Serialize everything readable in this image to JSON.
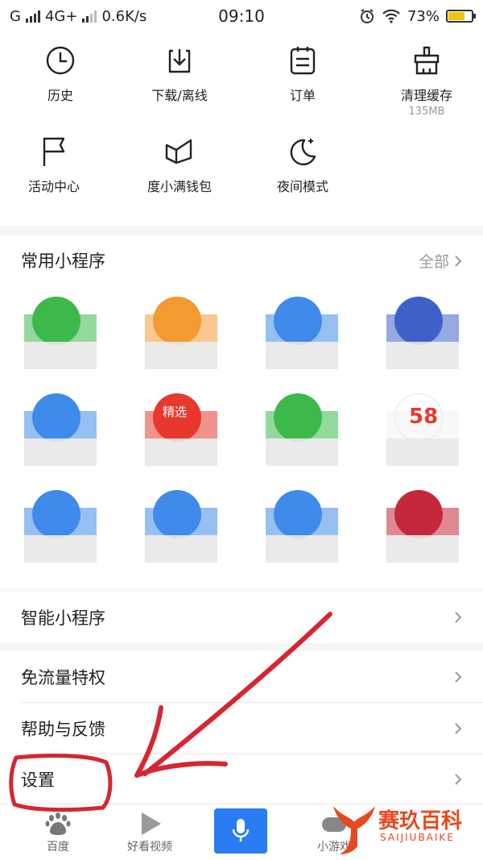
{
  "status_bar": {
    "carrier1": "G",
    "carrier2": "4G+",
    "speed": "0.6K/s",
    "time": "09:10",
    "battery": "73%",
    "battery_level": 0.73
  },
  "tools": [
    {
      "label": "历史",
      "icon": "clock-icon"
    },
    {
      "label": "下载/离线",
      "icon": "download-icon"
    },
    {
      "label": "订单",
      "icon": "order-icon"
    },
    {
      "label": "清理缓存",
      "sub": "135MB",
      "icon": "broom-icon"
    },
    {
      "label": "活动中心",
      "icon": "flag-icon"
    },
    {
      "label": "度小满钱包",
      "icon": "wallet-icon"
    },
    {
      "label": "夜间模式",
      "icon": "moon-icon"
    }
  ],
  "miniapps": {
    "title": "常用小程序",
    "all_label": "全部",
    "item_colors": [
      "#3cb94a",
      "#f39a32",
      "#3f8bea",
      "#3e61c8",
      "#3f8bea",
      "#e8392e",
      "#3cb94a",
      "#ffffff",
      "#3f8bea",
      "#3f8bea",
      "#3f8bea",
      "#c5283a"
    ],
    "badge_58": "58",
    "badge_jingxuan": "精选"
  },
  "rows": {
    "smart_miniapps": "智能小程序",
    "free_data": "免流量特权",
    "help": "帮助与反馈",
    "settings": "设置"
  },
  "tabbar": {
    "home": "百度",
    "video": "好看视频",
    "mini": "小游戏"
  },
  "watermark": {
    "cn": "赛玖百科",
    "en": "SAIJIUBAIKE"
  },
  "colors": {
    "accent": "#2b7cf2",
    "annotation": "#d62630",
    "watermark": "#e8481f"
  }
}
